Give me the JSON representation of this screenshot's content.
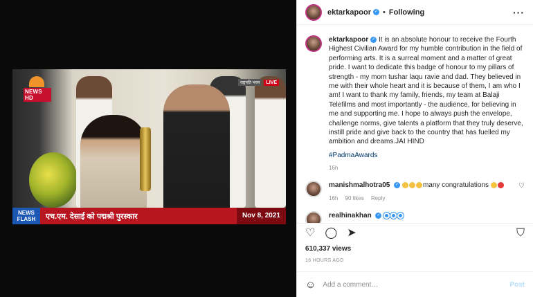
{
  "header": {
    "username": "ektarkapoor",
    "separator": "•",
    "follow_label": "Following",
    "more_icon": "more-icon"
  },
  "video": {
    "channel_logo": "NEWS HD",
    "live_channel": "राष्ट्रपति भवन",
    "live_label": "LIVE",
    "news_flash": "NEWS FLASH",
    "ticker_text": "एच.एम. देसाई को पद्मश्री पुरस्कार",
    "ticker_date": "Nov 8, 2021"
  },
  "caption": {
    "username": "ektarkapoor",
    "text": "It is an absolute honour to receive the Fourth Highest Civilian Award for my humble contribution in the field of performing arts. It is a surreal moment and a matter of great pride. I want to dedicate this badge of honour to my pillars of strength - my mom tushar laqu ravie and dad. They believed in me with their whole heart and it is because of them, I am who I am! I want to thank my family, friends, my team at Balaji Telefilms and most importantly - the audience, for believing in me and supporting me. I hope to always push the envelope, challenge norms, give talents a platform that they truly deserve, instill pride and give back to the country that has fuelled my ambition and dreams.JAI HIND",
    "hashtag": "#PadmaAwards",
    "time": "16h"
  },
  "comments": [
    {
      "username": "manishmalhotra05",
      "text": "many congratulations",
      "time": "16h",
      "likes": "90 likes",
      "reply": "Reply"
    },
    {
      "username": "realhinakhan"
    }
  ],
  "stats": {
    "views": "610,337 views",
    "time_ago": "16 HOURS AGO"
  },
  "composer": {
    "placeholder": "Add a comment…",
    "post_label": "Post"
  },
  "colors": {
    "verified": "#3897f0",
    "link": "#00376b",
    "post_disabled": "#b2dffc",
    "ticker_red": "#b7151f"
  }
}
